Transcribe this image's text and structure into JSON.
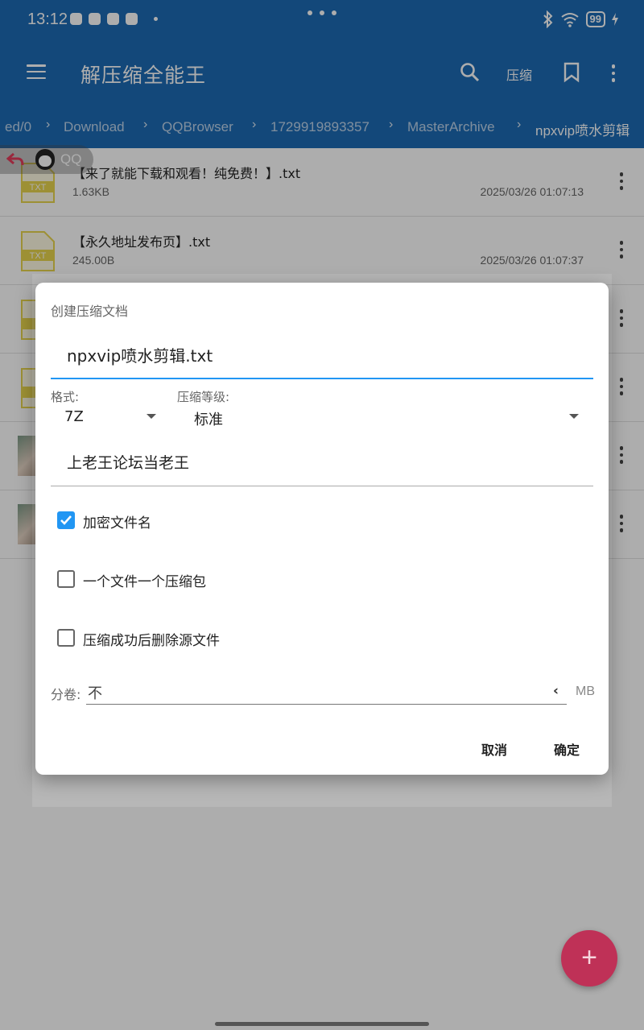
{
  "status_bar": {
    "time": "13:12",
    "battery": "99"
  },
  "app_bar": {
    "title": "解压缩全能王",
    "compress_label": "压缩"
  },
  "breadcrumb": {
    "items": [
      "ed/0",
      "Download",
      "QQBrowser",
      "1729919893357",
      "MasterArchive",
      "npxvip喷水剪辑"
    ],
    "separator": "›"
  },
  "qq_pill": {
    "label": "QQ"
  },
  "files": [
    {
      "name": "【来了就能下载和观看！纯免费！】.txt",
      "size": "1.63KB",
      "date": "2025/03/26 01:07:13",
      "icon_label": "TXT"
    },
    {
      "name": "【永久地址发布页】.txt",
      "size": "245.00B",
      "date": "2025/03/26 01:07:37",
      "icon_label": "TXT"
    }
  ],
  "dialog": {
    "title": "创建压缩文档",
    "filename": "npxvip喷水剪辑.txt",
    "format_label": "格式:",
    "format_value": "7Z",
    "level_label": "压缩等级:",
    "level_value": "标准",
    "password": "上老王论坛当老王",
    "options": [
      {
        "label": "加密文件名",
        "checked": true
      },
      {
        "label": "一个文件一个压缩包",
        "checked": false
      },
      {
        "label": "压缩成功后删除源文件",
        "checked": false
      }
    ],
    "split_label": "分卷:",
    "split_value": "不",
    "split_unit": "MB",
    "cancel_label": "取消",
    "confirm_label": "确定"
  },
  "fab": {
    "symbol": "+"
  },
  "colors": {
    "primary": "#1c6ab4",
    "accent": "#2196f3",
    "fab": "#bf3157",
    "txt_icon": "#e8d44d"
  }
}
